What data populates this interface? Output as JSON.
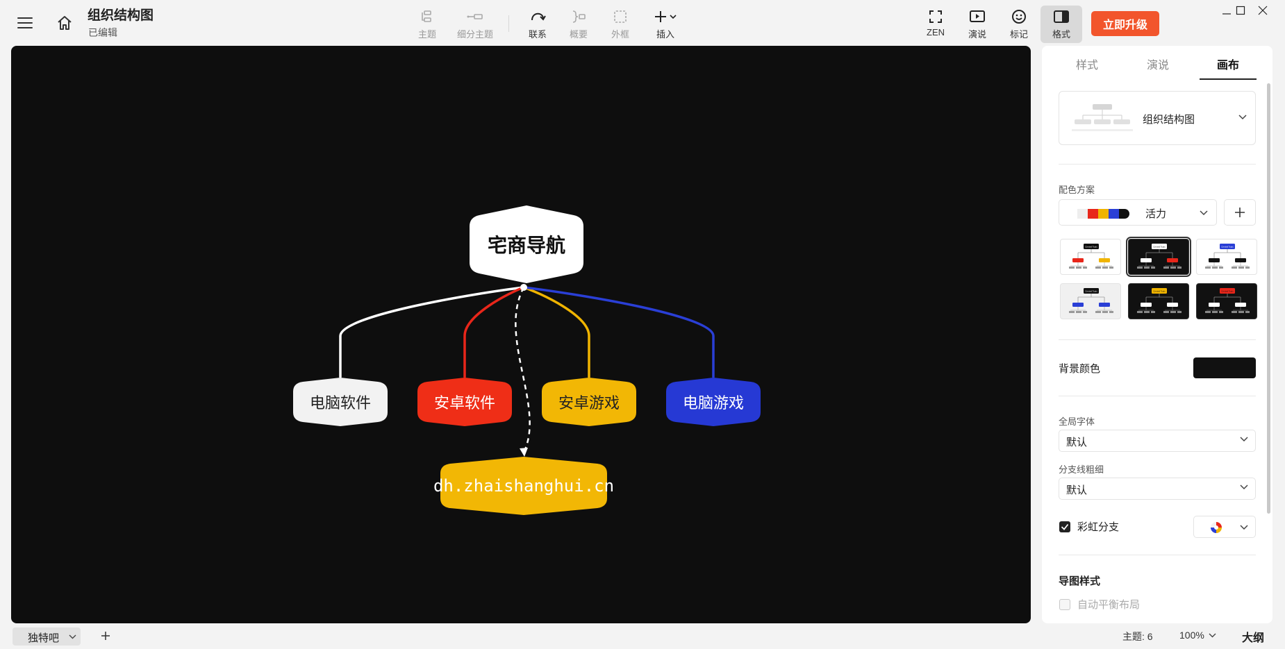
{
  "header": {
    "title": "组织结构图",
    "status": "已编辑",
    "upgrade_label": "立即升级"
  },
  "toolbar": {
    "topic": "主题",
    "subtopic": "细分主题",
    "relation": "联系",
    "summary": "概要",
    "boundary": "外框",
    "insert": "插入",
    "zen": "ZEN",
    "present": "演说",
    "marker": "标记",
    "format": "格式"
  },
  "mindmap": {
    "root": {
      "label": "宅商导航",
      "fill": "#ffffff",
      "text_color": "#111111"
    },
    "children": [
      {
        "label": "电脑软件",
        "fill": "#f2f2f2",
        "text_color": "#222222",
        "line_color": "#ffffff"
      },
      {
        "label": "安卓软件",
        "fill": "#ef2e17",
        "text_color": "#ffffff",
        "line_color": "#e8261a"
      },
      {
        "label": "安卓游戏",
        "fill": "#f2b705",
        "text_color": "#222222",
        "line_color": "#f0b400"
      },
      {
        "label": "电脑游戏",
        "fill": "#2639d4",
        "text_color": "#ffffff",
        "line_color": "#2a3fd6"
      }
    ],
    "floating": {
      "label": "dh.zhaishanghui.cn",
      "fill": "#f2b705",
      "text_color": "#ffffff"
    },
    "background": "#0e0e0e"
  },
  "panel": {
    "tabs": [
      "样式",
      "演说",
      "画布"
    ],
    "active_tab": "画布",
    "template_name": "组织结构图",
    "color_scheme_label": "配色方案",
    "color_scheme_name": "活力",
    "scheme_colors": [
      "#eeeeee",
      "#e8261a",
      "#f0b400",
      "#2a3fd6",
      "#111111"
    ],
    "background_color_label": "背景颜色",
    "background_color": "#111111",
    "global_font_label": "全局字体",
    "global_font_value": "默认",
    "branch_width_label": "分支线粗细",
    "branch_width_value": "默认",
    "rainbow_branch_label": "彩虹分支",
    "rainbow_branch_checked": true,
    "map_style_label": "导图样式",
    "auto_balance_label": "自动平衡布局",
    "auto_balance_checked": false,
    "theme_thumb_text": "Central Topic"
  },
  "statusbar": {
    "sheet_name": "独特吧",
    "topic_count": "主题: 6",
    "zoom": "100%",
    "outline": "大纲"
  },
  "colors": {
    "accent": "#f2552c"
  }
}
